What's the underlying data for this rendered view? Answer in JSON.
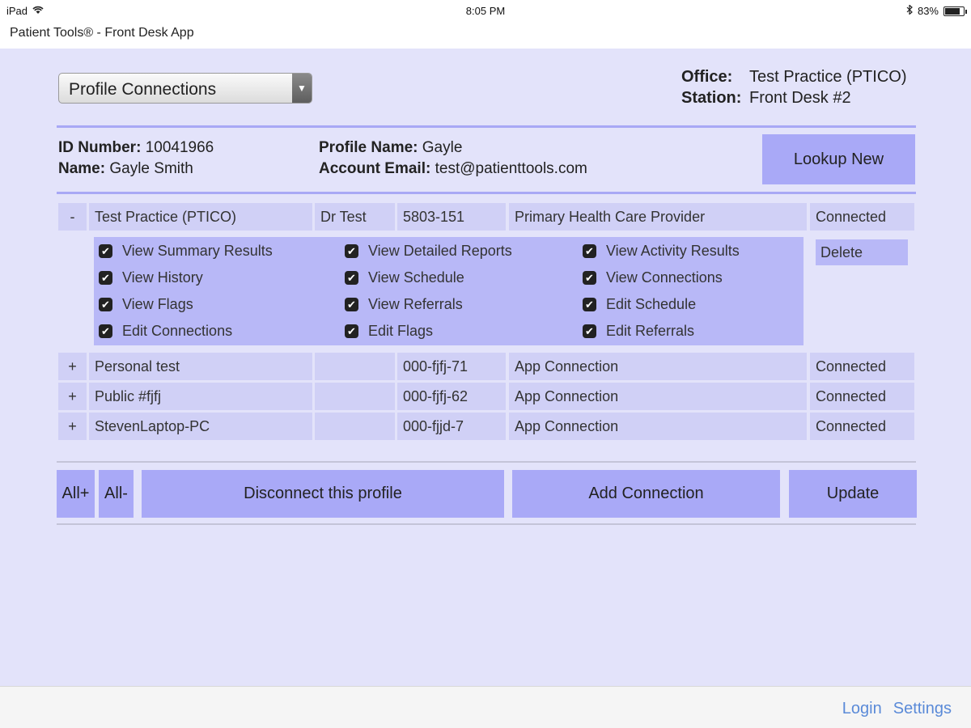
{
  "status_bar": {
    "device": "iPad",
    "time": "8:05 PM",
    "battery": "83%",
    "battery_level": 0.83
  },
  "app_title": "Patient Tools® - Front Desk App",
  "dropdown": {
    "selected": "Profile Connections"
  },
  "office": {
    "office_label": "Office:",
    "office_value": "Test Practice (PTICO)",
    "station_label": "Station:",
    "station_value": "Front Desk #2"
  },
  "profile": {
    "id_label": "ID Number:",
    "id_value": "10041966",
    "name_label": "Name:",
    "name_value": "Gayle Smith",
    "profile_name_label": "Profile Name:",
    "profile_name_value": "Gayle",
    "email_label": "Account Email:",
    "email_value": "test@patienttools.com"
  },
  "lookup_button": "Lookup New",
  "connections": [
    {
      "toggle": "-",
      "name": "Test Practice (PTICO)",
      "contact": "Dr Test",
      "code": "5803-151",
      "type": "Primary Health Care Provider",
      "status": "Connected"
    },
    {
      "toggle": "+",
      "name": "Personal test",
      "contact": "",
      "code": "000-fjfj-71",
      "type": "App Connection",
      "status": "Connected"
    },
    {
      "toggle": "+",
      "name": "Public #fjfj",
      "contact": "",
      "code": "000-fjfj-62",
      "type": "App Connection",
      "status": "Connected"
    },
    {
      "toggle": "+",
      "name": "StevenLaptop-PC",
      "contact": "",
      "code": "000-fjjd-7",
      "type": "App Connection",
      "status": "Connected"
    }
  ],
  "permissions": [
    "View Summary Results",
    "View Detailed Reports",
    "View Activity Results",
    "View History",
    "View Schedule",
    "View Connections",
    "View Flags",
    "View Referrals",
    "Edit Schedule",
    "Edit Connections",
    "Edit Flags",
    "Edit Referrals"
  ],
  "delete_label": "Delete",
  "check_glyph": "✔",
  "actions": {
    "all_plus": "All+",
    "all_minus": "All-",
    "disconnect": "Disconnect this profile",
    "add": "Add Connection",
    "update": "Update"
  },
  "footer": {
    "login": "Login",
    "settings": "Settings"
  }
}
